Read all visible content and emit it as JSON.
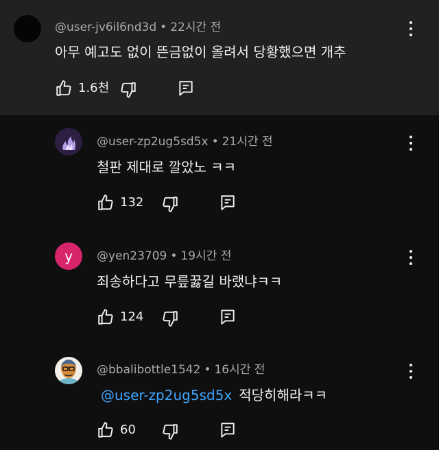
{
  "comments": [
    {
      "user": "@user-jv6il6nd3d",
      "time": "22시간 전",
      "text": "아무 예고도 없이 뜬금없이 올려서 당황했으면 개추",
      "likes": "1.6천",
      "avatar_icon": "black-circle-avatar"
    },
    {
      "user": "@user-zp2ug5sd5x",
      "time": "21시간 전",
      "text": "철판 제대로 깔았노 ㅋㅋ",
      "likes": "132",
      "avatar_icon": "purple-flame-avatar"
    },
    {
      "user": "@yen23709",
      "time": "19시간 전",
      "text": "죄송하다고 무릎꿇길 바랬냐ㅋㅋ",
      "likes": "124",
      "avatar_letter": "y",
      "avatar_color": "#d7246a"
    },
    {
      "user": "@bbalibottle1542",
      "time": "16시간 전",
      "mention": "@user-zp2ug5sd5x",
      "text": "적당히해라ㅋㅋ",
      "likes": "60",
      "avatar_icon": "cartoon-man-avatar"
    }
  ],
  "separator": "•",
  "colors": {
    "background": "#0f0f0f",
    "highlight_background": "#212121",
    "text": "#f1f1f1",
    "meta": "#aaaaaa",
    "mention": "#3ea6ff"
  }
}
